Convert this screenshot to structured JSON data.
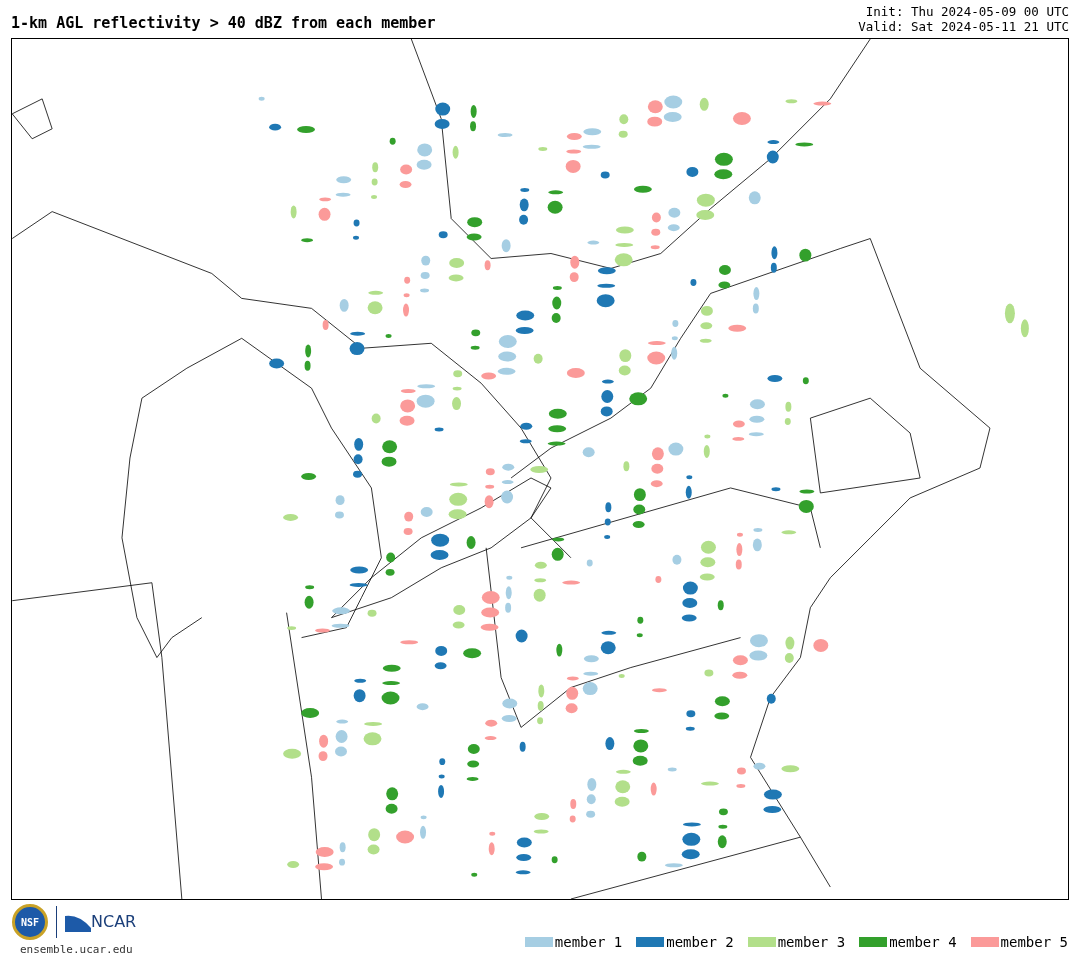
{
  "title": "1-km AGL reflectivity > 40 dBZ from each member",
  "init": "Init: Thu 2024-05-09 00 UTC",
  "valid": "Valid: Sat 2024-05-11 21 UTC",
  "logos": {
    "nsf": "NSF",
    "ncar": "NCAR"
  },
  "site": "ensemble.ucar.edu",
  "legend": [
    {
      "label": "member 1",
      "color": "#a6cee3"
    },
    {
      "label": "member 2",
      "color": "#1f78b4"
    },
    {
      "label": "member 3",
      "color": "#b2df8a"
    },
    {
      "label": "member 4",
      "color": "#33a02c"
    },
    {
      "label": "member 5",
      "color": "#fb9a99"
    }
  ]
}
